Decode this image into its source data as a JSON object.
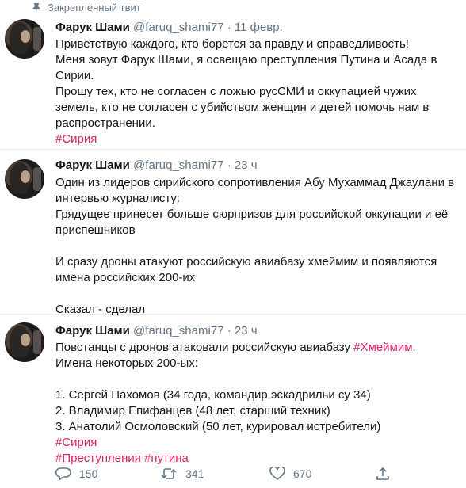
{
  "pinned_label": "Закрепленный твит",
  "tweets": [
    {
      "name": "Фарук Шами",
      "handle": "@faruq_shami77",
      "sep": "·",
      "time": "11 февр.",
      "lines": [
        "Приветствую каждого, кто борется за правду и справедливость!",
        "Меня зовут Фарук Шами, я освещаю преступления Путина и Асада в",
        "Сирии.",
        "Прошу тех, кто не согласен с ложью русСМИ и оккупацией чужих",
        "земель, кто не согласен с убийством женщин и детей помочь нам в",
        "распространении."
      ],
      "hashtag": "#Сирия"
    },
    {
      "name": "Фарук Шами",
      "handle": "@faruq_shami77",
      "sep": "·",
      "time": "23 ч",
      "lines": [
        "Один из лидеров сирийского сопротивления Абу Мухаммад Джаулани в",
        "интервью журналисту:",
        "Грядущее принесет больше сюрпризов для российской оккупации и её",
        "приспешников",
        "",
        "И сразу дроны атакуют российскую авиабазу хмеймим и появляются",
        "имена российских 200-их",
        "",
        "Сказал - сделал"
      ]
    },
    {
      "name": "Фарук Шами",
      "handle": "@faruq_shami77",
      "sep": "·",
      "time": "23 ч",
      "line1_text": "Повстанцы с дронов атаковали российскую авиабазу ",
      "line1_tag": "#Хмеймим",
      "line1_end": ".",
      "lines": [
        "Имена некоторых 200-ых:",
        "",
        "1. Сергей Пахомов (34 года, командир эскадрильи су 34)",
        "2. Владимир Епифанцев (48 лет, старший техник)",
        "3. Анатолий Осмоловский (50 лет, курировал истребители)"
      ],
      "tag_line1": "#Сирия",
      "tag_line2a": "#Преступления",
      "tag_line2b": "#путина",
      "actions": {
        "reply_count": "150",
        "retweet_count": "341",
        "like_count": "670"
      }
    }
  ]
}
